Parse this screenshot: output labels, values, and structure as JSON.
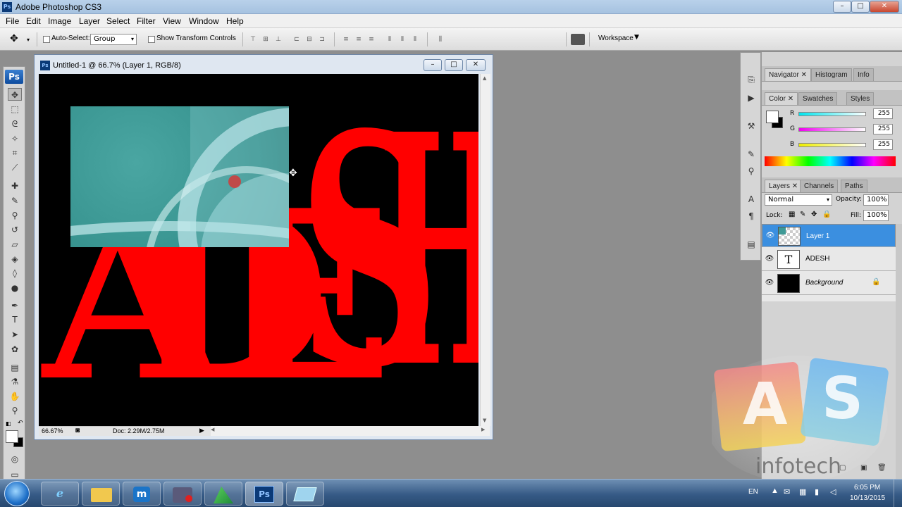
{
  "app": {
    "window_title": "Adobe Photoshop CS3",
    "logo": "Ps"
  },
  "menu": [
    "File",
    "Edit",
    "Image",
    "Layer",
    "Select",
    "Filter",
    "View",
    "Window",
    "Help"
  ],
  "options_bar": {
    "auto_select_label": "Auto-Select:",
    "auto_select_value": "Group",
    "show_transform_label": "Show Transform Controls",
    "workspace_label": "Workspace"
  },
  "document": {
    "title": "Untitled-1 @ 66.7% (Layer 1, RGB/8)",
    "zoom": "66.67%",
    "doc_size": "Doc: 2.29M/2.75M",
    "text_layer_content": "ADESH"
  },
  "panels": {
    "nav_tabs": [
      "Navigator",
      "Histogram",
      "Info"
    ],
    "color_tabs": [
      "Color",
      "Swatches",
      "Styles"
    ],
    "color": {
      "r_label": "R",
      "g_label": "G",
      "b_label": "B",
      "r_value": "255",
      "g_value": "255",
      "b_value": "255",
      "r_color": "#00e5ee",
      "g_color": "#ee00ee",
      "b_color": "#eeee00"
    },
    "layers_tabs": [
      "Layers",
      "Channels",
      "Paths"
    ],
    "blend_mode": "Normal",
    "opacity_label": "Opacity:",
    "opacity_value": "100%",
    "lock_label": "Lock:",
    "fill_label": "Fill:",
    "fill_value": "100%",
    "layers": [
      {
        "name": "Layer 1",
        "selected": true
      },
      {
        "name": "ADESH",
        "selected": false
      },
      {
        "name": "Background",
        "selected": false
      }
    ],
    "text_thumb_glyph": "T"
  },
  "taskbar": {
    "language": "EN",
    "time": "6:05 PM",
    "date": "10/13/2015",
    "ps_label": "Ps"
  },
  "watermark": {
    "letter_a": "A",
    "letter_s": "S",
    "brand": "infotech"
  },
  "colors": {
    "text_red": "#ff0000",
    "selected_layer": "#3b8fe0",
    "teal": "#3f9a96"
  }
}
